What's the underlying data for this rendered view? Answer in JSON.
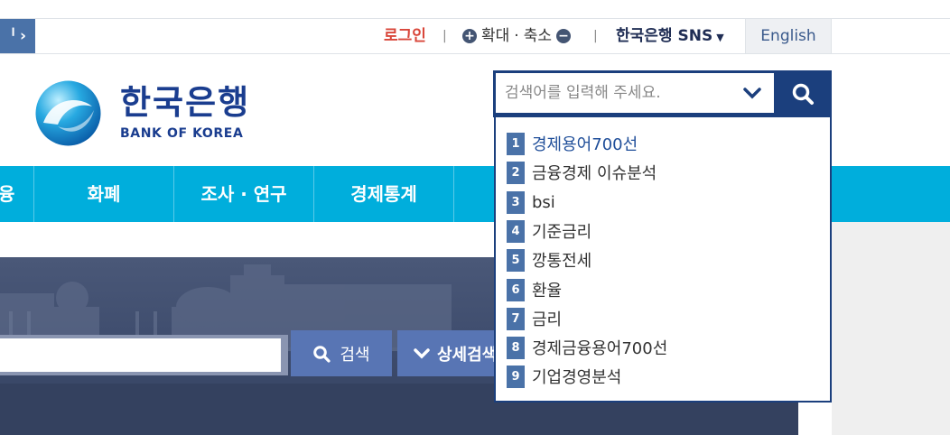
{
  "topbar": {
    "left_tab_label": "ᅵ",
    "left_tab_chevron": "›",
    "login": "로그인",
    "separator": "|",
    "zoom_in": "확대",
    "zoom_dot": "·",
    "zoom_out": "축소",
    "sns": "한국은행 SNS",
    "english": "English"
  },
  "logo": {
    "title": "한국은행",
    "subtitle": "BANK OF KOREA"
  },
  "search": {
    "placeholder": "검색어를 입력해 주세요.",
    "suggestions": [
      {
        "rank": "1",
        "text": "경제용어700선"
      },
      {
        "rank": "2",
        "text": "금융경제 이슈분석"
      },
      {
        "rank": "3",
        "text": "bsi"
      },
      {
        "rank": "4",
        "text": "기준금리"
      },
      {
        "rank": "5",
        "text": "깡통전세"
      },
      {
        "rank": "6",
        "text": "환율"
      },
      {
        "rank": "7",
        "text": "금리"
      },
      {
        "rank": "8",
        "text": "경제금융용어700선"
      },
      {
        "rank": "9",
        "text": "기업경영분석"
      }
    ]
  },
  "nav": {
    "items": [
      "융",
      "화폐",
      "조사 · 연구",
      "경제통계"
    ]
  },
  "hero": {
    "search_label": "검색",
    "detail_label": "상세검색"
  },
  "colors": {
    "nav_bg": "#00aedc",
    "search_frame": "#1b3f7d",
    "rank_badge": "#4a72a8",
    "login": "#d9463a",
    "hero_button": "#5875b4"
  }
}
